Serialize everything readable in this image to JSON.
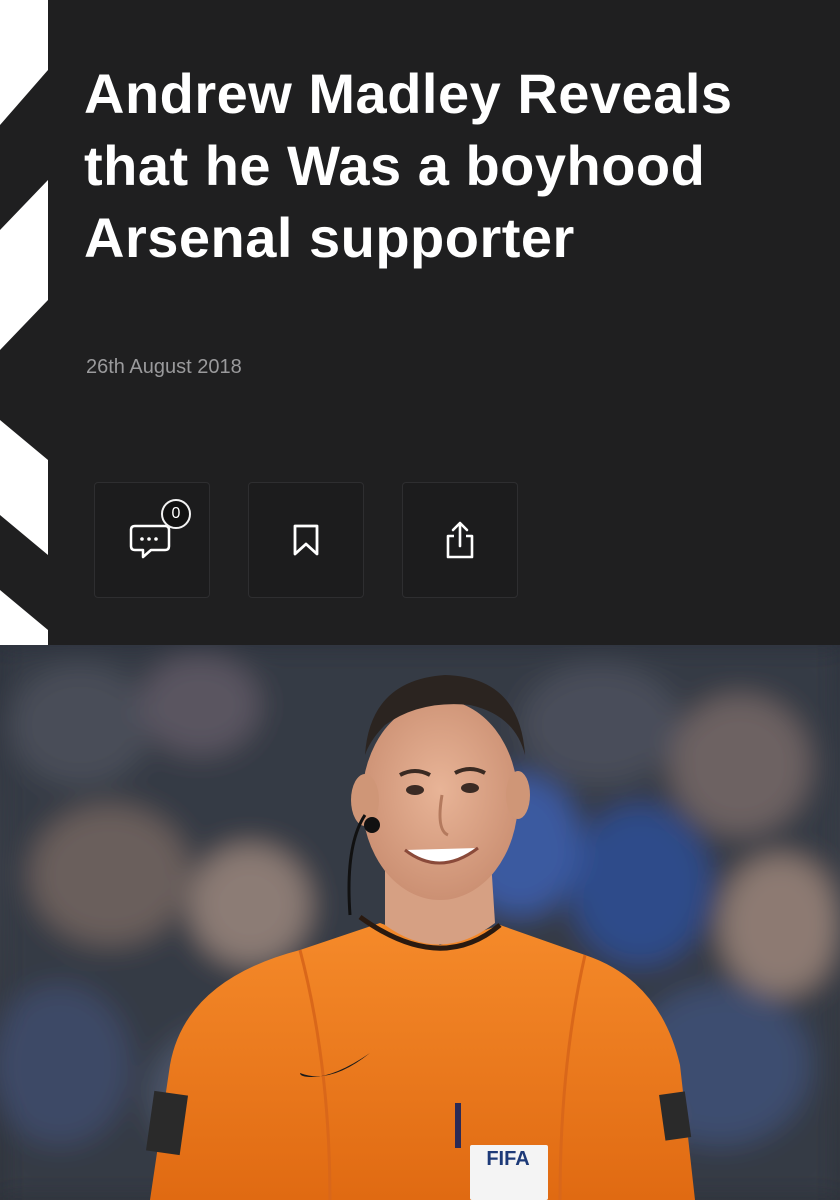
{
  "article": {
    "title": "Andrew Madley Reveals that he Was a boyhood Arsenal supporter",
    "date": "26th August 2018"
  },
  "actions": [
    {
      "name": "comments",
      "icon": "comment-icon",
      "count": "0"
    },
    {
      "name": "bookmark",
      "icon": "bookmark-icon"
    },
    {
      "name": "share",
      "icon": "share-icon"
    }
  ],
  "photo": {
    "badge_text": "FIFA"
  },
  "colors": {
    "header_background": "#1f1f20",
    "title_text": "#ffffff",
    "date_text": "#9a9a9c",
    "shirt_orange": "#f07a1e"
  }
}
